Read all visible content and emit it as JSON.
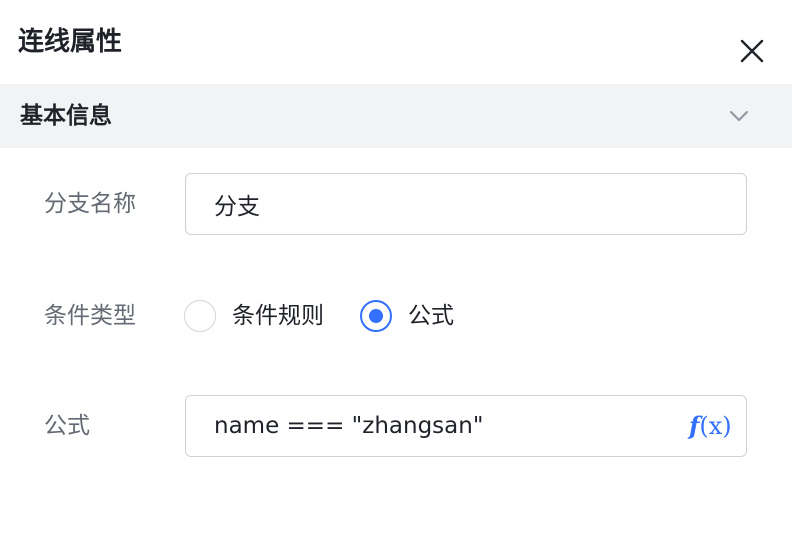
{
  "panel": {
    "title": "连线属性"
  },
  "section": {
    "title": "基本信息",
    "expanded": true
  },
  "form": {
    "branch_name": {
      "label": "分支名称",
      "value": "分支"
    },
    "condition_type": {
      "label": "条件类型",
      "options": [
        {
          "label": "条件规则",
          "checked": false
        },
        {
          "label": "公式",
          "checked": true
        }
      ]
    },
    "formula": {
      "label": "公式",
      "value": "name === \"zhangsan\"",
      "fx_glyph": "f",
      "fx_arg": "(x)"
    }
  },
  "colors": {
    "accent": "#3370ff",
    "label_text": "#646a73",
    "border": "#d0d3d6",
    "section_bg": "#f2f3f5"
  }
}
